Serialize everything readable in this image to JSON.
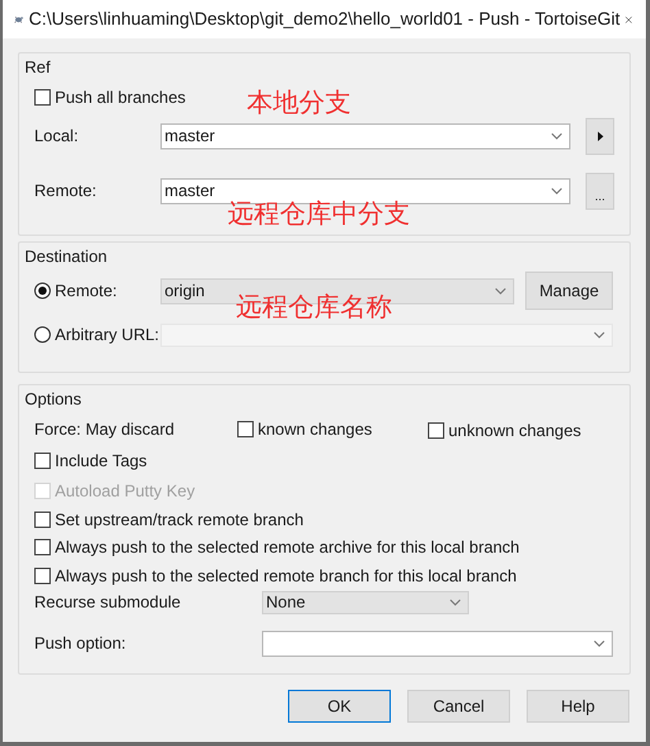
{
  "window": {
    "title": "C:\\Users\\linhuaming\\Desktop\\git_demo2\\hello_world01 - Push - TortoiseGit"
  },
  "ref": {
    "title": "Ref",
    "push_all": {
      "label": "Push all branches",
      "checked": false
    },
    "local": {
      "label": "Local:",
      "value": "master"
    },
    "remote": {
      "label": "Remote:",
      "value": "master",
      "button": "..."
    }
  },
  "destination": {
    "title": "Destination",
    "manage_button": "Manage",
    "choices": [
      {
        "label": "Remote:",
        "selected": true,
        "value": "origin"
      },
      {
        "label": "Arbitrary URL:",
        "selected": false
      }
    ]
  },
  "options": {
    "title": "Options",
    "force_label": "Force: May discard",
    "force_checks": [
      {
        "label": "known changes",
        "checked": false
      },
      {
        "label": "unknown changes",
        "checked": false
      }
    ],
    "checks": [
      {
        "label": "Include Tags",
        "checked": false,
        "disabled": false
      },
      {
        "label": "Autoload Putty Key",
        "checked": false,
        "disabled": true
      },
      {
        "label": "Set upstream/track remote branch",
        "checked": false,
        "disabled": false
      },
      {
        "label": "Always push to the selected remote archive for this local branch",
        "checked": false,
        "disabled": false
      },
      {
        "label": "Always push to the selected remote branch for this local branch",
        "checked": false,
        "disabled": false
      }
    ],
    "recurse": {
      "label": "Recurse submodule",
      "value": "None"
    },
    "push_option": {
      "label": "Push option:"
    }
  },
  "buttons": [
    {
      "label": "OK",
      "default": true
    },
    {
      "label": "Cancel",
      "default": false
    },
    {
      "label": "Help",
      "default": false
    }
  ],
  "annotations": [
    "本地分支",
    "远程仓库中分支",
    "远程仓库名称"
  ]
}
